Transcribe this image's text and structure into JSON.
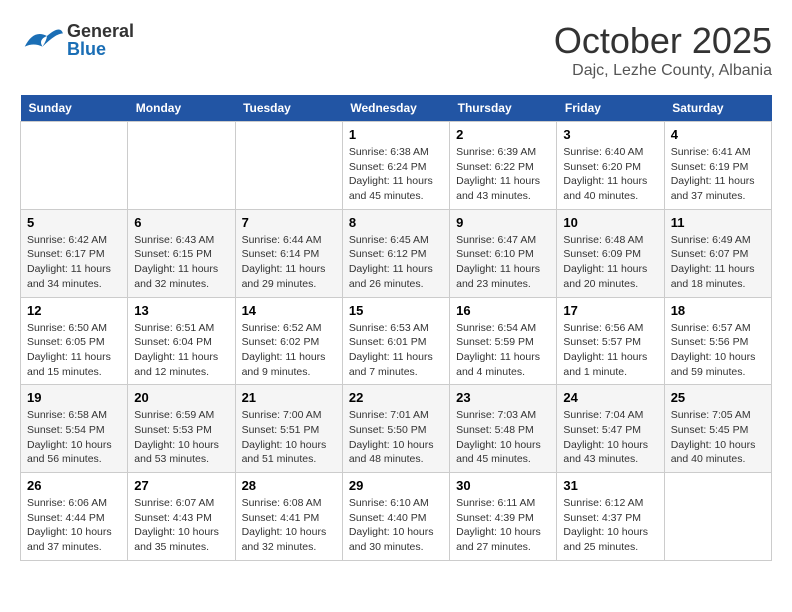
{
  "header": {
    "logo_general": "General",
    "logo_blue": "Blue",
    "month_title": "October 2025",
    "location": "Dajc, Lezhe County, Albania"
  },
  "weekdays": [
    "Sunday",
    "Monday",
    "Tuesday",
    "Wednesday",
    "Thursday",
    "Friday",
    "Saturday"
  ],
  "weeks": [
    {
      "days": [
        {
          "num": "",
          "info": ""
        },
        {
          "num": "",
          "info": ""
        },
        {
          "num": "",
          "info": ""
        },
        {
          "num": "1",
          "info": "Sunrise: 6:38 AM\nSunset: 6:24 PM\nDaylight: 11 hours\nand 45 minutes."
        },
        {
          "num": "2",
          "info": "Sunrise: 6:39 AM\nSunset: 6:22 PM\nDaylight: 11 hours\nand 43 minutes."
        },
        {
          "num": "3",
          "info": "Sunrise: 6:40 AM\nSunset: 6:20 PM\nDaylight: 11 hours\nand 40 minutes."
        },
        {
          "num": "4",
          "info": "Sunrise: 6:41 AM\nSunset: 6:19 PM\nDaylight: 11 hours\nand 37 minutes."
        }
      ]
    },
    {
      "days": [
        {
          "num": "5",
          "info": "Sunrise: 6:42 AM\nSunset: 6:17 PM\nDaylight: 11 hours\nand 34 minutes."
        },
        {
          "num": "6",
          "info": "Sunrise: 6:43 AM\nSunset: 6:15 PM\nDaylight: 11 hours\nand 32 minutes."
        },
        {
          "num": "7",
          "info": "Sunrise: 6:44 AM\nSunset: 6:14 PM\nDaylight: 11 hours\nand 29 minutes."
        },
        {
          "num": "8",
          "info": "Sunrise: 6:45 AM\nSunset: 6:12 PM\nDaylight: 11 hours\nand 26 minutes."
        },
        {
          "num": "9",
          "info": "Sunrise: 6:47 AM\nSunset: 6:10 PM\nDaylight: 11 hours\nand 23 minutes."
        },
        {
          "num": "10",
          "info": "Sunrise: 6:48 AM\nSunset: 6:09 PM\nDaylight: 11 hours\nand 20 minutes."
        },
        {
          "num": "11",
          "info": "Sunrise: 6:49 AM\nSunset: 6:07 PM\nDaylight: 11 hours\nand 18 minutes."
        }
      ]
    },
    {
      "days": [
        {
          "num": "12",
          "info": "Sunrise: 6:50 AM\nSunset: 6:05 PM\nDaylight: 11 hours\nand 15 minutes."
        },
        {
          "num": "13",
          "info": "Sunrise: 6:51 AM\nSunset: 6:04 PM\nDaylight: 11 hours\nand 12 minutes."
        },
        {
          "num": "14",
          "info": "Sunrise: 6:52 AM\nSunset: 6:02 PM\nDaylight: 11 hours\nand 9 minutes."
        },
        {
          "num": "15",
          "info": "Sunrise: 6:53 AM\nSunset: 6:01 PM\nDaylight: 11 hours\nand 7 minutes."
        },
        {
          "num": "16",
          "info": "Sunrise: 6:54 AM\nSunset: 5:59 PM\nDaylight: 11 hours\nand 4 minutes."
        },
        {
          "num": "17",
          "info": "Sunrise: 6:56 AM\nSunset: 5:57 PM\nDaylight: 11 hours\nand 1 minute."
        },
        {
          "num": "18",
          "info": "Sunrise: 6:57 AM\nSunset: 5:56 PM\nDaylight: 10 hours\nand 59 minutes."
        }
      ]
    },
    {
      "days": [
        {
          "num": "19",
          "info": "Sunrise: 6:58 AM\nSunset: 5:54 PM\nDaylight: 10 hours\nand 56 minutes."
        },
        {
          "num": "20",
          "info": "Sunrise: 6:59 AM\nSunset: 5:53 PM\nDaylight: 10 hours\nand 53 minutes."
        },
        {
          "num": "21",
          "info": "Sunrise: 7:00 AM\nSunset: 5:51 PM\nDaylight: 10 hours\nand 51 minutes."
        },
        {
          "num": "22",
          "info": "Sunrise: 7:01 AM\nSunset: 5:50 PM\nDaylight: 10 hours\nand 48 minutes."
        },
        {
          "num": "23",
          "info": "Sunrise: 7:03 AM\nSunset: 5:48 PM\nDaylight: 10 hours\nand 45 minutes."
        },
        {
          "num": "24",
          "info": "Sunrise: 7:04 AM\nSunset: 5:47 PM\nDaylight: 10 hours\nand 43 minutes."
        },
        {
          "num": "25",
          "info": "Sunrise: 7:05 AM\nSunset: 5:45 PM\nDaylight: 10 hours\nand 40 minutes."
        }
      ]
    },
    {
      "days": [
        {
          "num": "26",
          "info": "Sunrise: 6:06 AM\nSunset: 4:44 PM\nDaylight: 10 hours\nand 37 minutes."
        },
        {
          "num": "27",
          "info": "Sunrise: 6:07 AM\nSunset: 4:43 PM\nDaylight: 10 hours\nand 35 minutes."
        },
        {
          "num": "28",
          "info": "Sunrise: 6:08 AM\nSunset: 4:41 PM\nDaylight: 10 hours\nand 32 minutes."
        },
        {
          "num": "29",
          "info": "Sunrise: 6:10 AM\nSunset: 4:40 PM\nDaylight: 10 hours\nand 30 minutes."
        },
        {
          "num": "30",
          "info": "Sunrise: 6:11 AM\nSunset: 4:39 PM\nDaylight: 10 hours\nand 27 minutes."
        },
        {
          "num": "31",
          "info": "Sunrise: 6:12 AM\nSunset: 4:37 PM\nDaylight: 10 hours\nand 25 minutes."
        },
        {
          "num": "",
          "info": ""
        }
      ]
    }
  ]
}
